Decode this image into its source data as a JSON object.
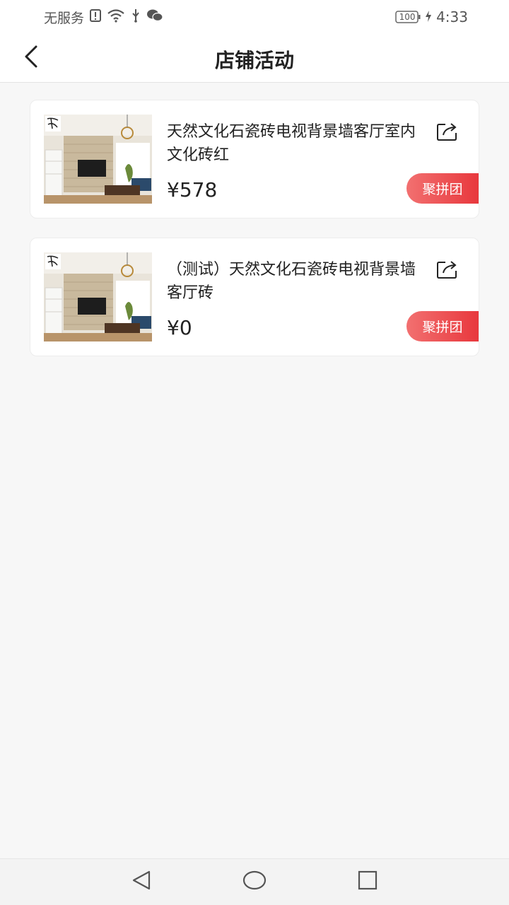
{
  "statusbar": {
    "carrier": "无服务",
    "battery": "100",
    "time": "4:33"
  },
  "navbar": {
    "title": "店铺活动"
  },
  "products": [
    {
      "title": "天然文化石瓷砖电视背景墙客厅室内文化砖红",
      "price": "¥578",
      "tag": "聚拼团"
    },
    {
      "title": "（测试）天然文化石瓷砖电视背景墙客厅砖",
      "price": "¥0",
      "tag": "聚拼团"
    }
  ],
  "colors": {
    "accent_start": "#f27070",
    "accent_end": "#e8383d",
    "background": "#f7f7f7"
  }
}
